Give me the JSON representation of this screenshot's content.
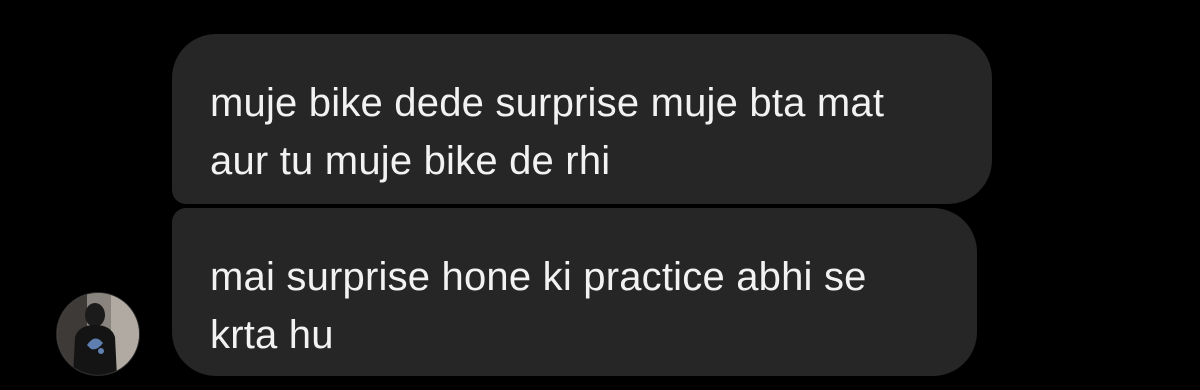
{
  "messages": [
    {
      "lines": [
        "muje bike dede surprise muje bta mat",
        "aur tu muje bike de rhi"
      ]
    },
    {
      "lines": [
        "mai surprise hone ki practice abhi se",
        "krta hu"
      ]
    }
  ],
  "sender": {
    "avatar_icon": "profile-photo-avatar"
  },
  "colors": {
    "background": "#000000",
    "bubble": "#262626",
    "text": "#f2f2f2"
  }
}
